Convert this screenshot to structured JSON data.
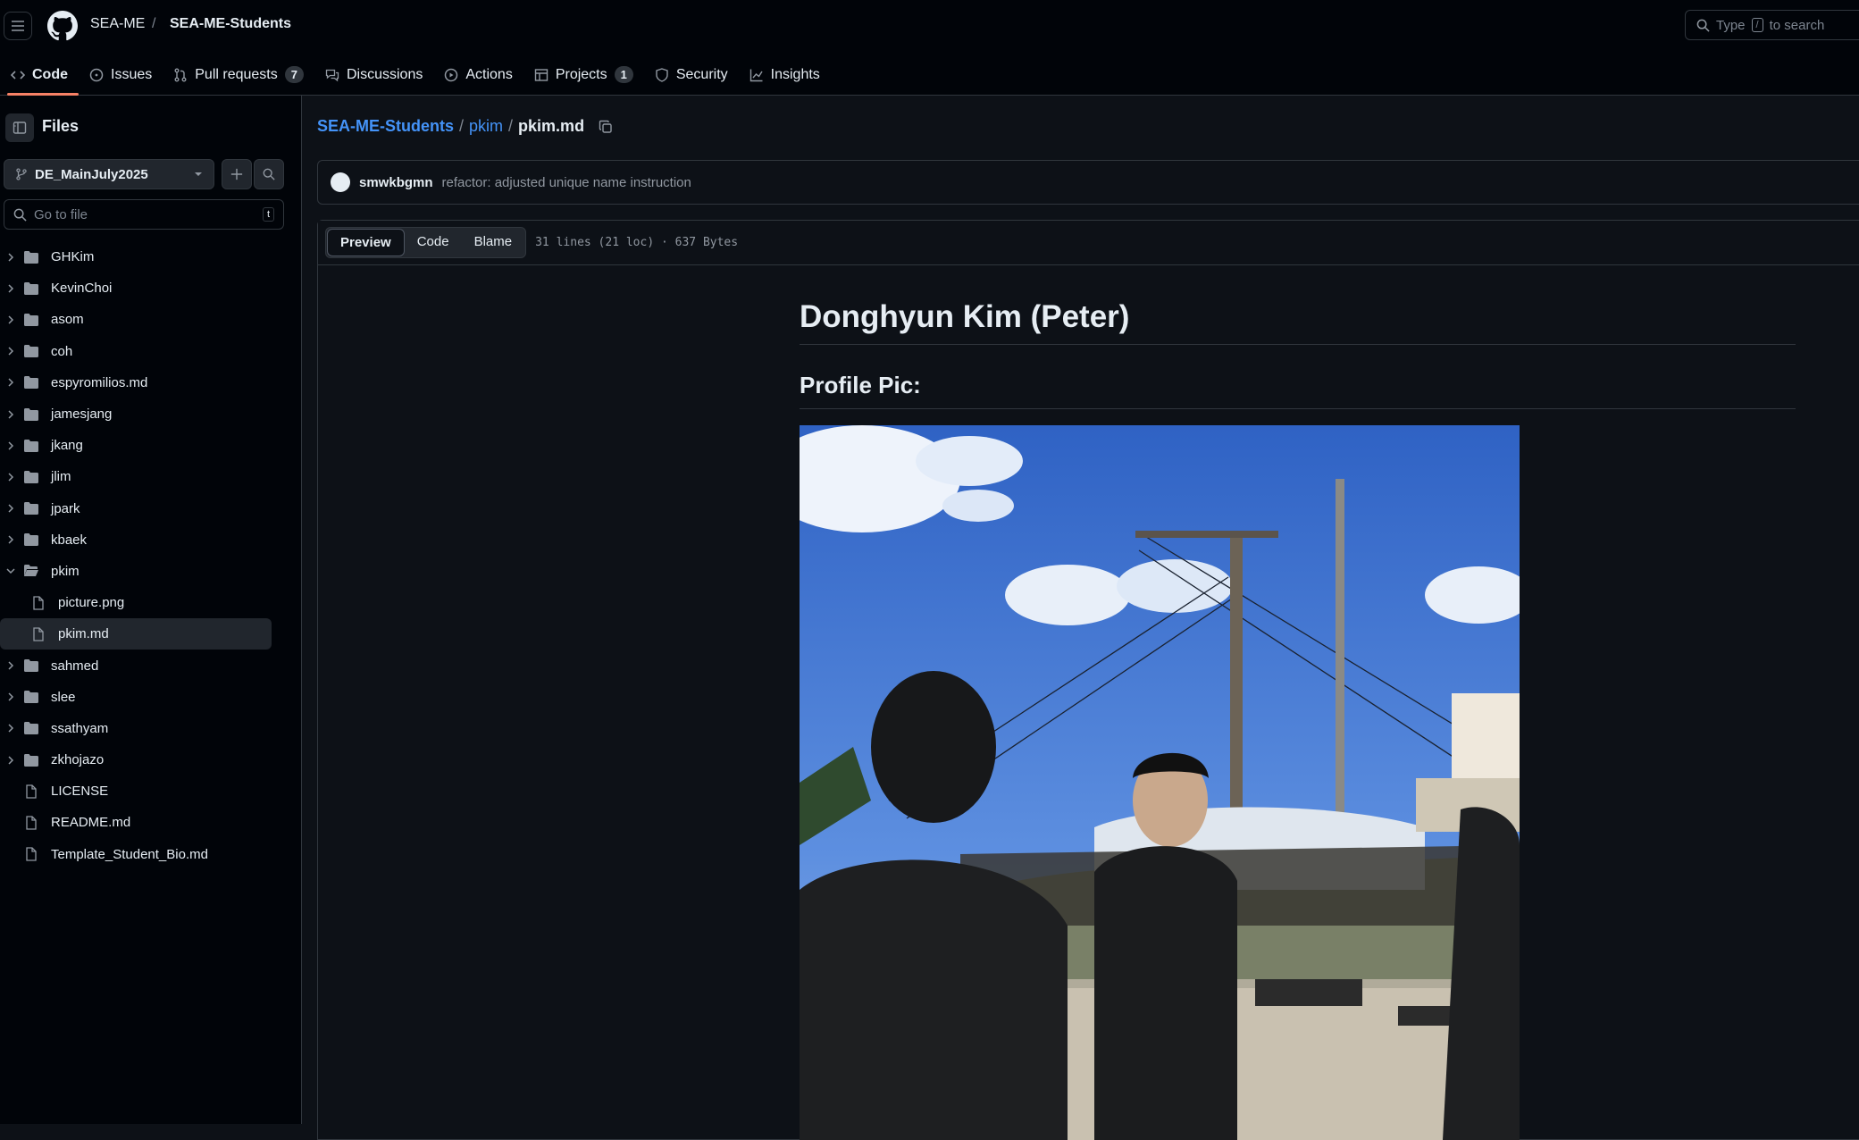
{
  "header": {
    "owner": "SEA-ME",
    "separator": "/",
    "repo": "SEA-ME-Students",
    "search_prefix": "Type",
    "search_key": "/",
    "search_suffix": "to search"
  },
  "nav": {
    "tabs": [
      {
        "label": "Code",
        "icon": "code-icon",
        "active": true
      },
      {
        "label": "Issues",
        "icon": "issue-icon"
      },
      {
        "label": "Pull requests",
        "icon": "pull-request-icon",
        "count": "7"
      },
      {
        "label": "Discussions",
        "icon": "discussion-icon"
      },
      {
        "label": "Actions",
        "icon": "play-icon"
      },
      {
        "label": "Projects",
        "icon": "table-icon",
        "count": "1"
      },
      {
        "label": "Security",
        "icon": "shield-icon"
      },
      {
        "label": "Insights",
        "icon": "graph-icon"
      }
    ]
  },
  "sidebar": {
    "title": "Files",
    "branch": "DE_MainJuly2025",
    "goto_placeholder": "Go to file",
    "goto_key": "t",
    "tree": [
      {
        "name": "GHKim",
        "type": "folder"
      },
      {
        "name": "KevinChoi",
        "type": "folder"
      },
      {
        "name": "asom",
        "type": "folder"
      },
      {
        "name": "coh",
        "type": "folder"
      },
      {
        "name": "espyromilios.md",
        "type": "folder"
      },
      {
        "name": "jamesjang",
        "type": "folder"
      },
      {
        "name": "jkang",
        "type": "folder"
      },
      {
        "name": "jlim",
        "type": "folder"
      },
      {
        "name": "jpark",
        "type": "folder"
      },
      {
        "name": "kbaek",
        "type": "folder"
      },
      {
        "name": "pkim",
        "type": "folder-open"
      },
      {
        "name": "picture.png",
        "type": "file-child"
      },
      {
        "name": "pkim.md",
        "type": "file-child",
        "selected": true
      },
      {
        "name": "sahmed",
        "type": "folder"
      },
      {
        "name": "slee",
        "type": "folder"
      },
      {
        "name": "ssathyam",
        "type": "folder"
      },
      {
        "name": "zkhojazo",
        "type": "folder"
      },
      {
        "name": "LICENSE",
        "type": "file"
      },
      {
        "name": "README.md",
        "type": "file"
      },
      {
        "name": "Template_Student_Bio.md",
        "type": "file"
      }
    ]
  },
  "main": {
    "path": {
      "repo": "SEA-ME-Students",
      "sep": "/",
      "dir": "pkim",
      "file": "pkim.md"
    },
    "commit": {
      "author": "smwkbgmn",
      "message": "refactor: adjusted unique name instruction"
    },
    "viewer": {
      "tabs": [
        "Preview",
        "Code",
        "Blame"
      ],
      "active_tab": "Preview",
      "meta": "31 lines (21 loc) · 637 Bytes"
    },
    "markdown": {
      "h1": "Donghyun Kim (Peter)",
      "h2": "Profile Pic:"
    }
  },
  "colors": {
    "accent": "#4493f8",
    "tab_underline": "#f78166",
    "bg": "#0d1117"
  }
}
